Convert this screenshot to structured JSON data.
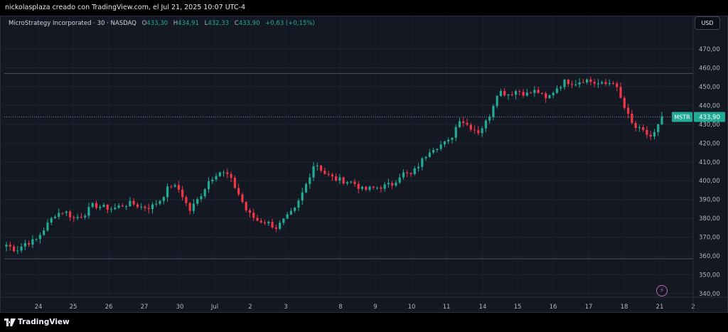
{
  "caption": "nickolasplaza creado con TradingView.com, el Jul 21, 2025 10:07 UTC-4",
  "legend": {
    "symbol": "MicroStrategy Incorporated · 30 · NASDAQ",
    "o_label": "O",
    "o_value": "433,30",
    "h_label": "H",
    "h_value": "434,91",
    "l_label": "L",
    "l_value": "432,33",
    "c_label": "C",
    "c_value": "433,90",
    "change": "+0,63 (+0,15%)"
  },
  "currency_button": "USD",
  "footer_brand": "TradingView",
  "icons": {
    "alert": "lightning-icon",
    "logo": "tradingview-logo-icon"
  },
  "colors": {
    "up": "#22ab94",
    "down": "#f23645",
    "background": "#141823",
    "price_label": "#22ab94"
  },
  "chart_data": {
    "type": "candlestick",
    "ticker": "MSTR",
    "last_price": 433.9,
    "last_price_label": "433,90",
    "symbol_label": "MSTR",
    "y_ticks": [
      "470,00",
      "460,00",
      "450,00",
      "440,00",
      "430,00",
      "420,00",
      "410,00",
      "400,00",
      "390,00",
      "380,00",
      "370,00",
      "360,00",
      "350,00",
      "340,00"
    ],
    "ylim": [
      336,
      475
    ],
    "x_ticks": [
      "24",
      "25",
      "26",
      "27",
      "30",
      "Jul",
      "2",
      "3",
      "8",
      "9",
      "10",
      "11",
      "14",
      "15",
      "16",
      "17",
      "18",
      "21",
      "2"
    ],
    "horizontal_levels": [
      457,
      358.5
    ],
    "grid": true,
    "anchors": [
      [
        0,
        366
      ],
      [
        1,
        363
      ],
      [
        2,
        367
      ],
      [
        3,
        368
      ],
      [
        4,
        375
      ],
      [
        5,
        382
      ],
      [
        6,
        384
      ],
      [
        7,
        380
      ],
      [
        8,
        382
      ],
      [
        9,
        387
      ],
      [
        10,
        386
      ],
      [
        11,
        385
      ],
      [
        12,
        387
      ],
      [
        13,
        388
      ],
      [
        14,
        386
      ],
      [
        15,
        386
      ],
      [
        16,
        390
      ],
      [
        17,
        398
      ],
      [
        18,
        395
      ],
      [
        19,
        384
      ],
      [
        20,
        391
      ],
      [
        21,
        400
      ],
      [
        22,
        405
      ],
      [
        23,
        403
      ],
      [
        24,
        394
      ],
      [
        25,
        383
      ],
      [
        26,
        379
      ],
      [
        27,
        378
      ],
      [
        28,
        375
      ],
      [
        29,
        380
      ],
      [
        30,
        385
      ],
      [
        31,
        397
      ],
      [
        32,
        410
      ],
      [
        33,
        404
      ],
      [
        34,
        401
      ],
      [
        35,
        400
      ],
      [
        36,
        399
      ],
      [
        37,
        395
      ],
      [
        38,
        396
      ],
      [
        39,
        397
      ],
      [
        40,
        398
      ],
      [
        41,
        404
      ],
      [
        42,
        403
      ],
      [
        43,
        410
      ],
      [
        44,
        417
      ],
      [
        45,
        419
      ],
      [
        46,
        421
      ],
      [
        47,
        433
      ],
      [
        48,
        429
      ],
      [
        49,
        426
      ],
      [
        50,
        433
      ],
      [
        51,
        448
      ],
      [
        52,
        446
      ],
      [
        53,
        448
      ],
      [
        54,
        446
      ],
      [
        55,
        448
      ],
      [
        56,
        443
      ],
      [
        57,
        449
      ],
      [
        58,
        453
      ],
      [
        59,
        452
      ],
      [
        60,
        454
      ],
      [
        61,
        452
      ],
      [
        62,
        451
      ],
      [
        63,
        453
      ],
      [
        64,
        440
      ],
      [
        65,
        429
      ],
      [
        66,
        426
      ],
      [
        67,
        423
      ],
      [
        68,
        433
      ]
    ],
    "candle_count": 176
  }
}
